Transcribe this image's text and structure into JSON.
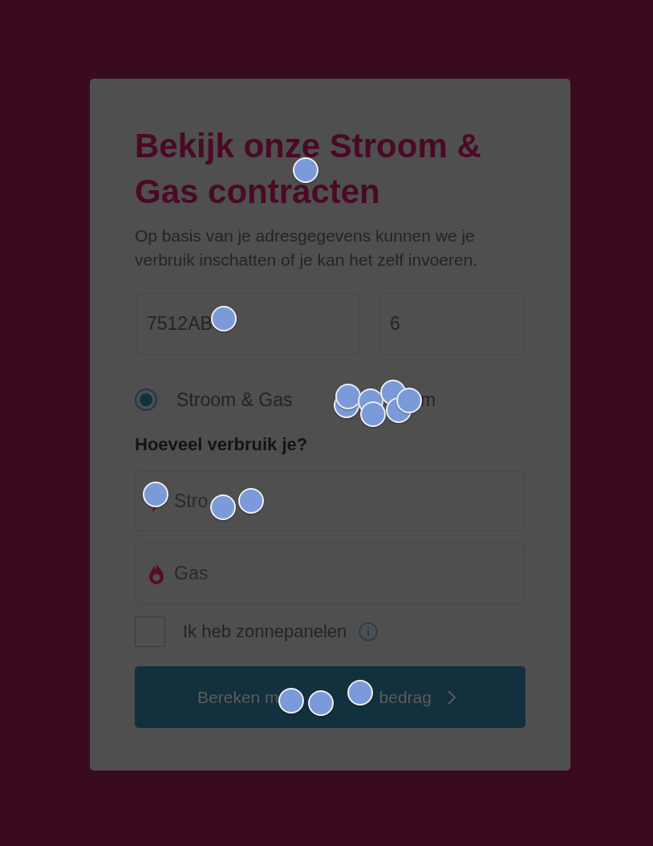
{
  "click_markers": true,
  "form": {
    "title": "Bekijk onze Stroom & Gas contracten",
    "intro": "Op basis van je adresgegevens kunnen we je verbruik inschatten of je kan het zelf invoeren.",
    "address_fields": [
      {
        "kind": "postcode",
        "value": "7512AB"
      },
      {
        "kind": "house_number",
        "value": "6"
      }
    ],
    "energy_options": [
      {
        "label": "Stroom & Gas",
        "selected": true
      },
      {
        "label": "m"
      }
    ],
    "usage_heading": "Hoeveel verbruik je?",
    "usage_fields": [
      {
        "kind": "electricity",
        "placeholder": "Stro"
      },
      {
        "kind": "gas",
        "placeholder": "Gas"
      }
    ],
    "solar_panels": {
      "label": "Ik heb zonnepanelen",
      "checked": false
    },
    "submit": {
      "label_parts": [
        "Bereken m",
        "bedrag"
      ]
    }
  }
}
